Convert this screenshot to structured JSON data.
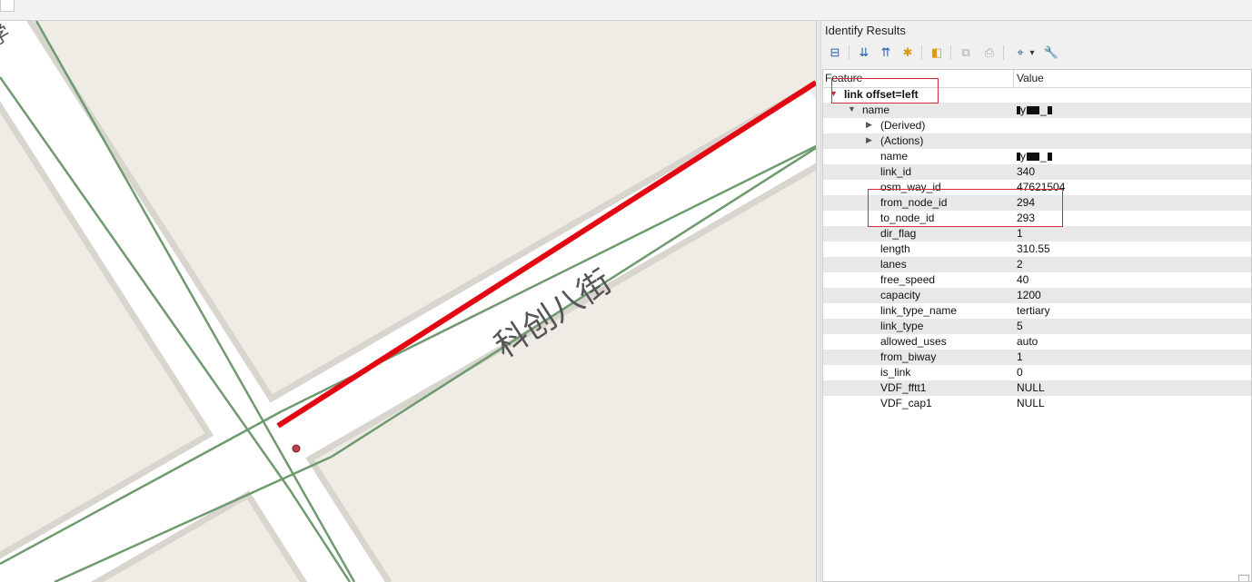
{
  "panel": {
    "title": "Identify Results",
    "toolbar": [
      {
        "icon": "expand-tree-icon",
        "glyph": "⊟"
      },
      {
        "icon": "expand-all-icon",
        "glyph": "⇊"
      },
      {
        "icon": "collapse-all-icon",
        "glyph": "⇈"
      },
      {
        "icon": "expand-new-icon",
        "glyph": "✱"
      },
      {
        "icon": "clear-highlights-icon",
        "glyph": "◧"
      },
      {
        "icon": "copy-feature-icon",
        "glyph": "⧉"
      },
      {
        "icon": "print-icon",
        "glyph": "⎙"
      },
      {
        "icon": "identify-mode-icon",
        "glyph": "⌖"
      },
      {
        "icon": "dropdown-chevron-icon",
        "glyph": "▾"
      },
      {
        "icon": "settings-wrench-icon",
        "glyph": "🔧"
      }
    ]
  },
  "tree": {
    "header_feature": "Feature",
    "header_value": "Value",
    "layer": "link offset=left",
    "feature_name_label": "name",
    "feature_name_value_visible": "y _",
    "derived": "(Derived)",
    "actions": "(Actions)",
    "attributes": [
      {
        "key": "name",
        "value": "y _"
      },
      {
        "key": "link_id",
        "value": "340"
      },
      {
        "key": "osm_way_id",
        "value": "47621504"
      },
      {
        "key": "from_node_id",
        "value": "294"
      },
      {
        "key": "to_node_id",
        "value": "293"
      },
      {
        "key": "dir_flag",
        "value": "1"
      },
      {
        "key": "length",
        "value": "310.55"
      },
      {
        "key": "lanes",
        "value": "2"
      },
      {
        "key": "free_speed",
        "value": "40"
      },
      {
        "key": "capacity",
        "value": "1200"
      },
      {
        "key": "link_type_name",
        "value": "tertiary"
      },
      {
        "key": "link_type",
        "value": "5"
      },
      {
        "key": "allowed_uses",
        "value": "auto"
      },
      {
        "key": "from_biway",
        "value": "1"
      },
      {
        "key": "is_link",
        "value": "0"
      },
      {
        "key": "VDF_fftt1",
        "value": "NULL"
      },
      {
        "key": "VDF_cap1",
        "value": "NULL"
      }
    ]
  },
  "map": {
    "road_label": "科创八街",
    "corner_label": "学"
  },
  "colors": {
    "highlight_red": "#e30613",
    "link_green": "#6f9a6f",
    "annotation_box": "#d92b35"
  }
}
